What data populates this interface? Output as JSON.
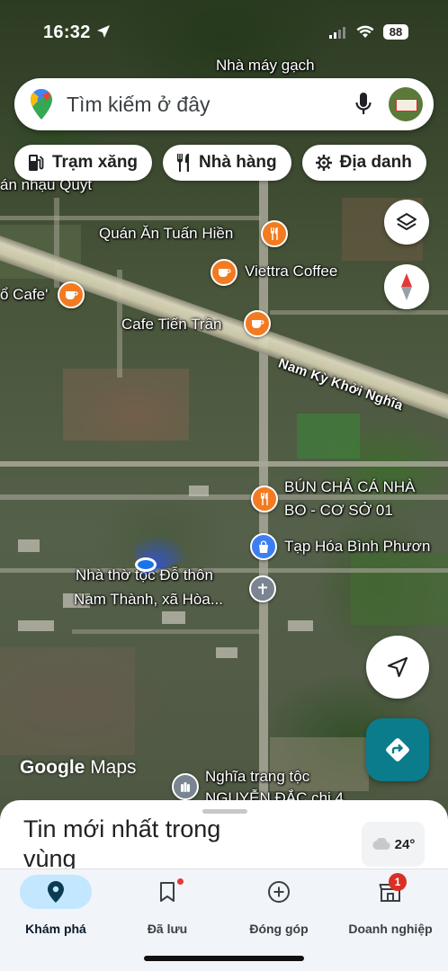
{
  "status_bar": {
    "time": "16:32",
    "battery": "88"
  },
  "search": {
    "placeholder": "Tìm kiếm ở đây"
  },
  "chips": [
    {
      "label": "Trạm xăng",
      "icon": "gas-station-icon"
    },
    {
      "label": "Nhà hàng",
      "icon": "restaurant-icon"
    },
    {
      "label": "Địa danh",
      "icon": "landmark-icon"
    }
  ],
  "map": {
    "labels": {
      "nha_may_gach": "Nhà máy gạch",
      "an_nhau_quyt": "án nhậu Quýt",
      "quan_an": "Quán Ăn Tuấn Hiền",
      "viettra": "Viettra Coffee",
      "cafe_left": "ổ Cafe'",
      "cafe_tien_tran": "Cafe Tiến Trần",
      "road": "Nam Kỳ Khởi Nghĩa",
      "bun_cha_1": "BÚN CHẢ CÁ NHÀ",
      "bun_cha_2": "BO - CƠ SỞ 01",
      "tap_hoa": "Tạp Hóa Bình Phươn",
      "nha_tho_1": "Nhà thờ tộc Đỗ thôn",
      "nha_tho_2": "Nam Thành, xã Hòa...",
      "nghia_trang_1": "Nghĩa trang tộc",
      "nghia_trang_2": "NGUYỄN ĐẮC chi 4"
    },
    "logo_google": "Google",
    "logo_maps": "Maps"
  },
  "sheet": {
    "title": "Tin mới nhất trong vùng",
    "weather": "24°"
  },
  "nav": [
    {
      "label": "Khám phá",
      "icon": "explore-pin-icon",
      "active": true
    },
    {
      "label": "Đã lưu",
      "icon": "bookmark-icon",
      "dot": true
    },
    {
      "label": "Đóng góp",
      "icon": "add-circle-icon"
    },
    {
      "label": "Doanh nghiệp",
      "icon": "business-icon",
      "badge": "1"
    }
  ],
  "colors": {
    "accent": "#0b7c8c",
    "poi_orange": "#f27b22",
    "poi_blue": "#3d7ff0",
    "nav_active": "#c2e7ff"
  }
}
